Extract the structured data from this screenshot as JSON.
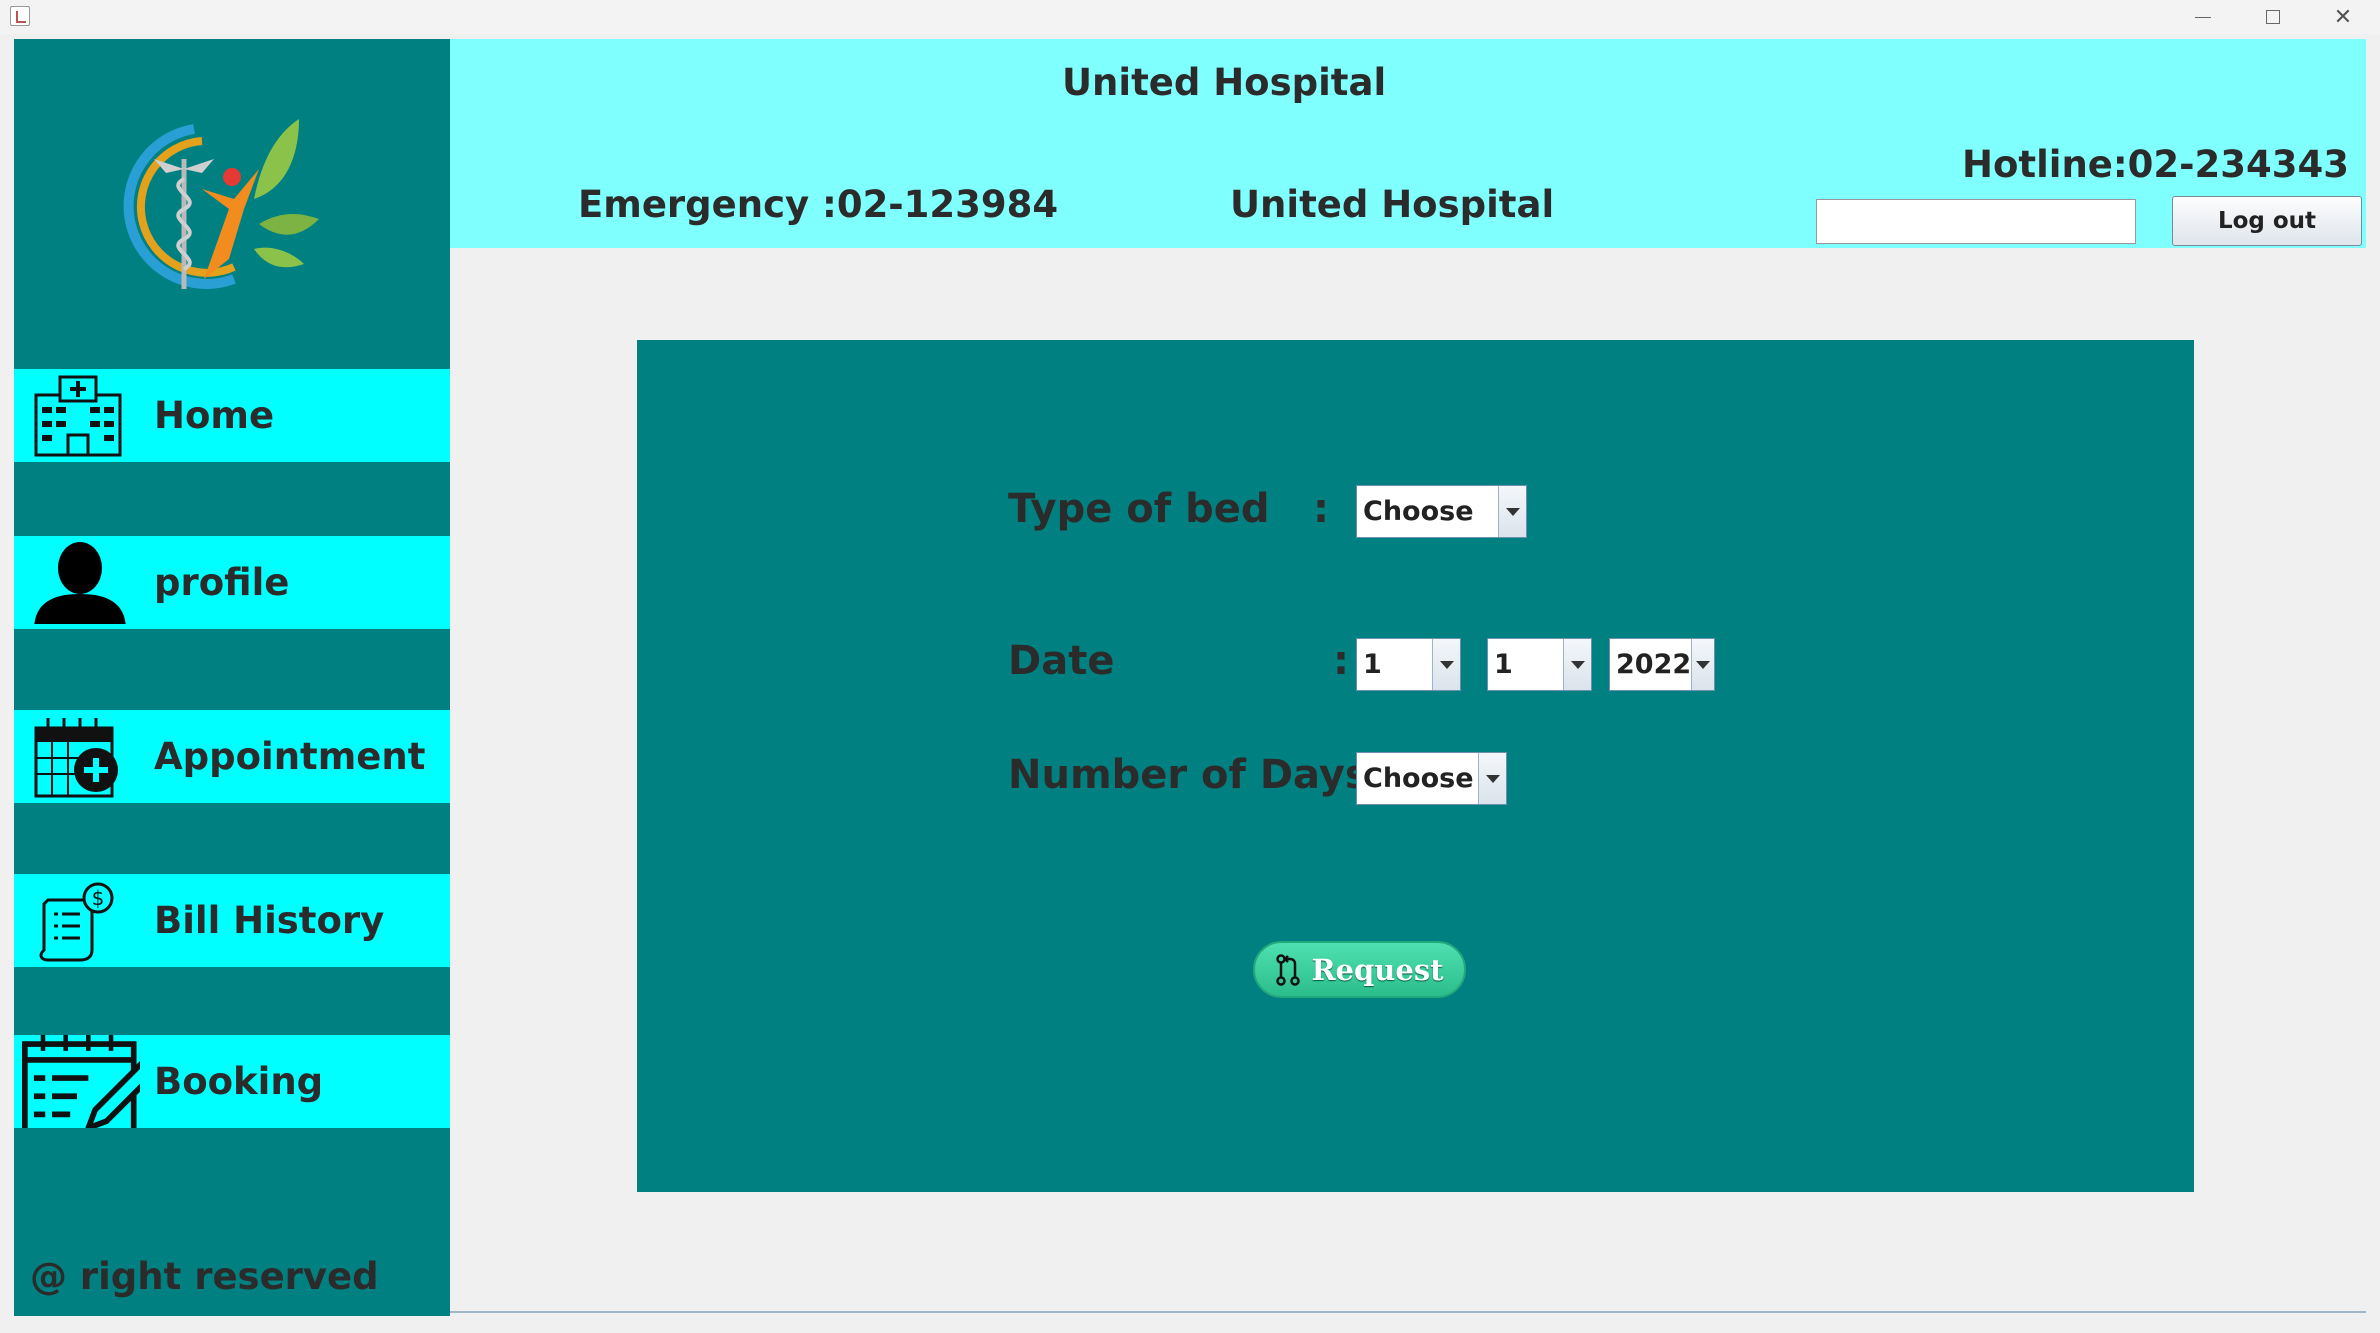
{
  "window": {
    "minimize": "—",
    "maximize": "☐",
    "close": "✕"
  },
  "sidebar": {
    "items": [
      {
        "label": "Home",
        "icon": "hospital-building-icon"
      },
      {
        "label": "profile",
        "icon": "user-icon"
      },
      {
        "label": "Appointment",
        "icon": "calendar-plus-icon"
      },
      {
        "label": "Bill History",
        "icon": "bill-receipt-icon"
      },
      {
        "label": "Booking",
        "icon": "booking-edit-icon"
      }
    ],
    "footer": "@ right reserved"
  },
  "header": {
    "title": "United Hospital",
    "emergency": "Emergency :02-123984",
    "name": "United Hospital",
    "hotline": "Hotline:02-234343",
    "search_value": "",
    "logout_label": "Log out"
  },
  "form": {
    "bed_label": "Type of bed",
    "bed_colon": ":",
    "bed_value": "Choose",
    "date_label": "Date",
    "date_colon": ":",
    "date_day": "1",
    "date_month": "1",
    "date_year": "2022",
    "days_label": "Number of Days:",
    "days_value": "Choose",
    "request_label": "Request"
  },
  "colors": {
    "sidebar": "#008080",
    "nav_item": "#00ffff",
    "header": "#80ffff",
    "panel": "#008080",
    "request_button": "#2bbd8b"
  }
}
